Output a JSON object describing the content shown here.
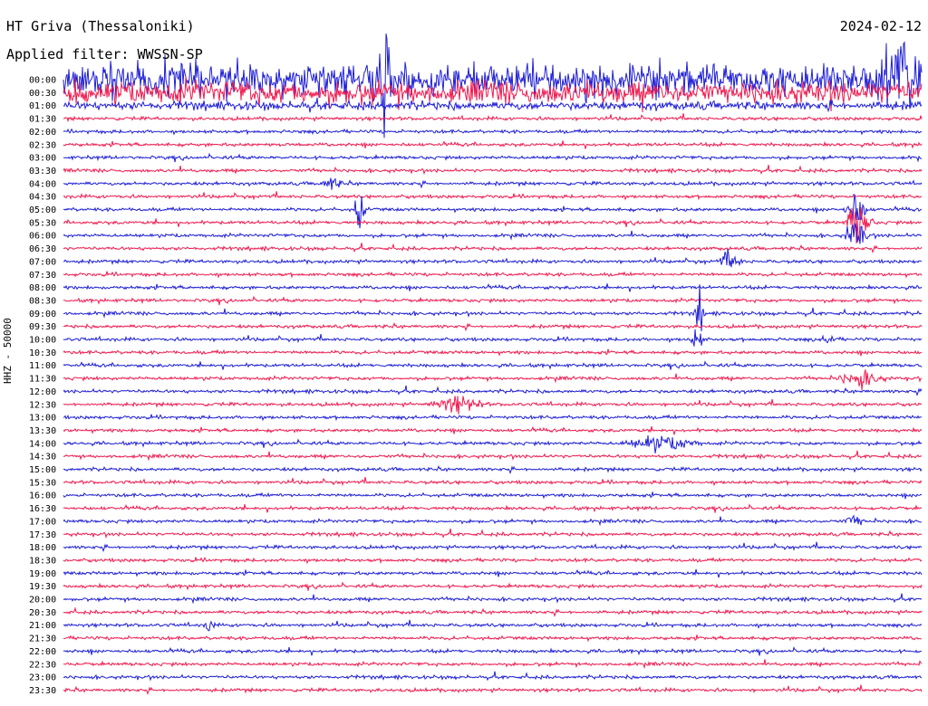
{
  "header": {
    "station": "HT Griva (Thessaloniki)",
    "date": "2024-02-12",
    "filter": "Applied filter: WWSSN-SP",
    "channel": "HHZ - 50000"
  },
  "colors": {
    "trace_a": "#1f1fd6",
    "trace_b": "#f01a4f",
    "background": "#ffffff",
    "text": "#000000"
  },
  "chart_data": {
    "type": "line",
    "title": "HT Griva (Thessaloniki)",
    "subtitle": "2024-02-12",
    "ylabel": "HHZ - 50000",
    "grid": false,
    "legend": "none",
    "series_colors": [
      "#1f1fd6",
      "#f01a4f"
    ],
    "y_ticks": [
      "00:00",
      "00:30",
      "01:00",
      "01:30",
      "02:00",
      "02:30",
      "03:00",
      "03:30",
      "04:00",
      "04:30",
      "05:00",
      "05:30",
      "06:00",
      "06:30",
      "07:00",
      "07:30",
      "08:00",
      "08:30",
      "09:00",
      "09:30",
      "10:00",
      "10:30",
      "11:00",
      "11:30",
      "12:00",
      "12:30",
      "13:00",
      "13:30",
      "14:00",
      "14:30",
      "15:00",
      "15:30",
      "16:00",
      "16:30",
      "17:00",
      "17:30",
      "18:00",
      "18:30",
      "19:00",
      "19:30",
      "20:00",
      "20:30",
      "21:00",
      "21:30",
      "22:00",
      "22:30",
      "23:00",
      "23:30"
    ]
  }
}
